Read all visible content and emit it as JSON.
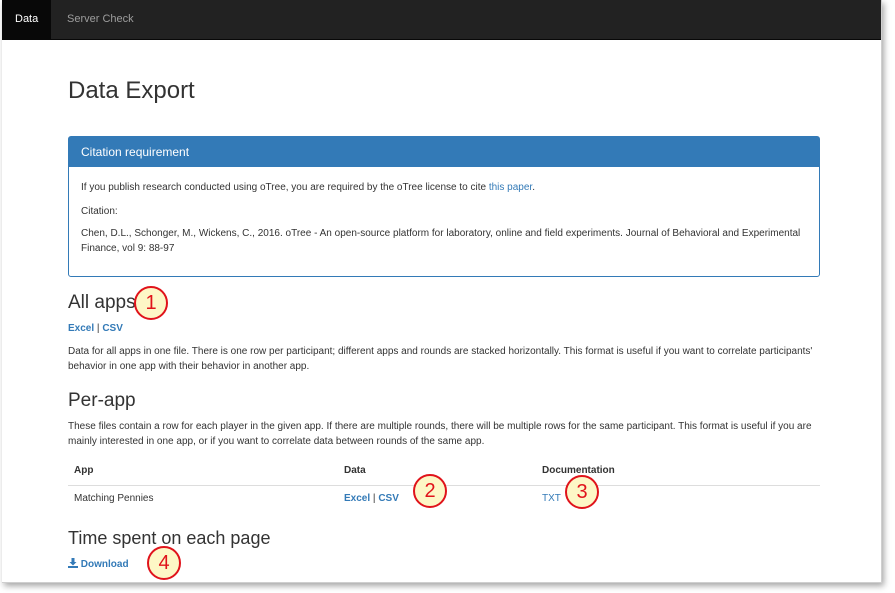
{
  "nav": {
    "tabs": [
      {
        "label": "Data",
        "active": true
      },
      {
        "label": "Server Check",
        "active": false
      }
    ]
  },
  "page": {
    "title": "Data Export"
  },
  "citation": {
    "heading": "Citation requirement",
    "text_before": "If you publish research conducted using oTree, you are required by the oTree license to cite ",
    "link": "this paper",
    "text_after": ".",
    "label": "Citation:",
    "reference": "Chen, D.L., Schonger, M., Wickens, C., 2016. oTree - An open-source platform for laboratory, online and field experiments. Journal of Behavioral and Experimental Finance, vol 9: 88-97"
  },
  "all_apps": {
    "heading": "All apps",
    "excel": "Excel",
    "sep": "|",
    "csv": "CSV",
    "description": "Data for all apps in one file. There is one row per participant; different apps and rounds are stacked horizontally. This format is useful if you want to correlate participants' behavior in one app with their behavior in another app."
  },
  "per_app": {
    "heading": "Per-app",
    "description": "These files contain a row for each player in the given app. If there are multiple rounds, there will be multiple rows for the same participant. This format is useful if you are mainly interested in one app, or if you want to correlate data between rounds of the same app.",
    "columns": [
      "App",
      "Data",
      "Documentation"
    ],
    "rows": [
      {
        "app": "Matching Pennies",
        "excel": "Excel",
        "sep": "|",
        "csv": "CSV",
        "doc": "TXT"
      }
    ]
  },
  "time_spent": {
    "heading": "Time spent on each page",
    "download": "Download"
  },
  "callouts": [
    "1",
    "2",
    "3",
    "4"
  ],
  "colors": {
    "link": "#337ab7",
    "panel": "#337ab7",
    "navbar": "#222222",
    "callout_border": "#e0131b",
    "callout_fill": "#fdf7c6"
  }
}
